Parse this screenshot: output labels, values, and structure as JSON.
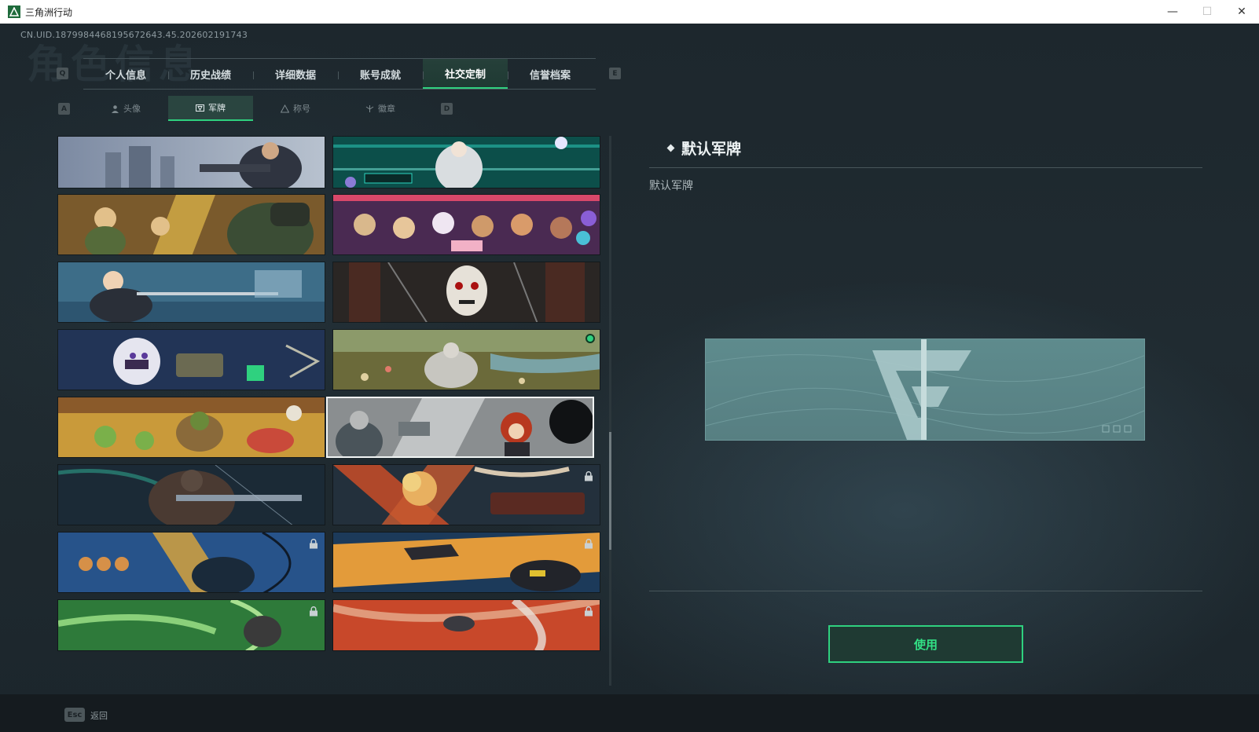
{
  "window": {
    "title": "三角洲行动",
    "buttons": {
      "minimize": "—",
      "maximize": "☐",
      "close": "✕"
    }
  },
  "uid": "CN.UID.1879984468195672643.45.202602191743",
  "background_title": "角色信息",
  "tabs": {
    "prev_key": "Q",
    "next_key": "E",
    "items": [
      {
        "label": "个人信息"
      },
      {
        "label": "历史战绩"
      },
      {
        "label": "详细数据"
      },
      {
        "label": "账号成就"
      },
      {
        "label": "社交定制",
        "active": true
      },
      {
        "label": "信誉档案"
      }
    ]
  },
  "subtabs": {
    "prev_key": "A",
    "next_key": "D",
    "items": [
      {
        "label": "头像",
        "icon": "person-icon"
      },
      {
        "label": "军牌",
        "icon": "badge-icon",
        "active": true
      },
      {
        "label": "称号",
        "icon": "title-icon"
      },
      {
        "label": "徽章",
        "icon": "emblem-icon"
      }
    ]
  },
  "nameplates": [
    {
      "name": "nameplate-city-soldier",
      "locked": false
    },
    {
      "name": "nameplate-neon-hacker",
      "locked": false
    },
    {
      "name": "nameplate-gunfight-comic",
      "locked": false
    },
    {
      "name": "nameplate-party-celebration",
      "locked": false
    },
    {
      "name": "nameplate-archer-stadium",
      "locked": false
    },
    {
      "name": "nameplate-saw-puppet",
      "locked": false
    },
    {
      "name": "nameplate-chibi-operator",
      "locked": false
    },
    {
      "name": "nameplate-flower-field-knight",
      "locked": false,
      "new": true
    },
    {
      "name": "nameplate-cooking-frogs",
      "locked": false
    },
    {
      "name": "nameplate-redhead-chibi",
      "locked": false,
      "selected": true
    },
    {
      "name": "nameplate-night-operator",
      "locked": false
    },
    {
      "name": "nameplate-explosion-comic",
      "locked": true
    },
    {
      "name": "nameplate-blue-archer",
      "locked": true
    },
    {
      "name": "nameplate-orange-drone",
      "locked": true
    },
    {
      "name": "nameplate-green-soldier",
      "locked": true
    },
    {
      "name": "nameplate-red-jet",
      "locked": true
    }
  ],
  "selected": {
    "title": "默认军牌",
    "subtitle": "默认军牌"
  },
  "use_button": "使用",
  "bottom": {
    "esc_key": "Esc",
    "esc_label": "返回"
  },
  "colors": {
    "accent": "#2fd17f",
    "active_tab_bg": "#26403a",
    "preview_bg": "#5e8b8d"
  }
}
